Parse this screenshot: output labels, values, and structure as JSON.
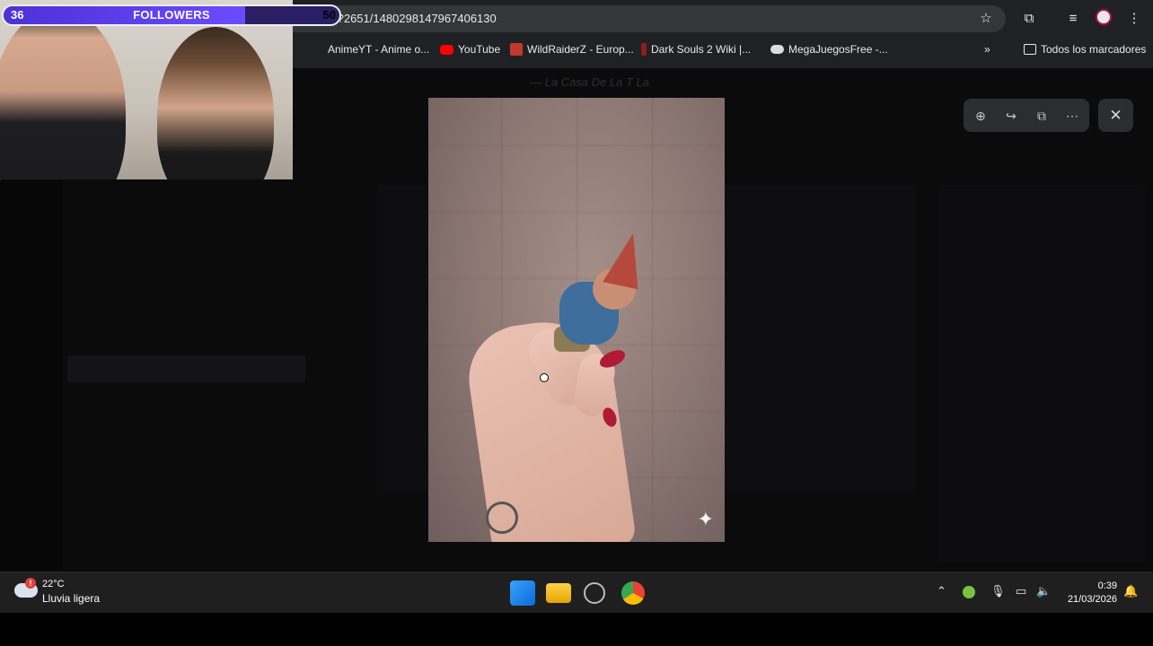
{
  "browser": {
    "url": "00528???2651/1480298147967406130",
    "bookmarks": [
      {
        "label": "AnimeYT - Anime o...",
        "icon": "animeyt-icon"
      },
      {
        "label": "YouTube",
        "icon": "youtube-icon"
      },
      {
        "label": "WildRaiderZ - Europ...",
        "icon": "wildraiderz-icon"
      },
      {
        "label": "Dark Souls 2 Wiki |...",
        "icon": "darksouls-icon"
      },
      {
        "label": "MegaJuegosFree -...",
        "icon": "gamepad-icon"
      }
    ],
    "all_bookmarks": "Todos los marcadores",
    "overflow": "»"
  },
  "overlay": {
    "followers_label": "FOLLOWERS",
    "followers_current": "36",
    "followers_goal": "50",
    "followers_progress": 0.72
  },
  "viewer": {
    "tools": [
      "zoom-in-icon",
      "share-icon",
      "open-external-icon",
      "more-icon"
    ],
    "close_icon": "close-icon",
    "sparkle_icon": "sparkle-icon"
  },
  "taskbar": {
    "weather_temp": "22°C",
    "weather_desc": "Lluvia ligera",
    "weather_badge": "!",
    "time": "0:39",
    "date": "21/03/2026"
  }
}
